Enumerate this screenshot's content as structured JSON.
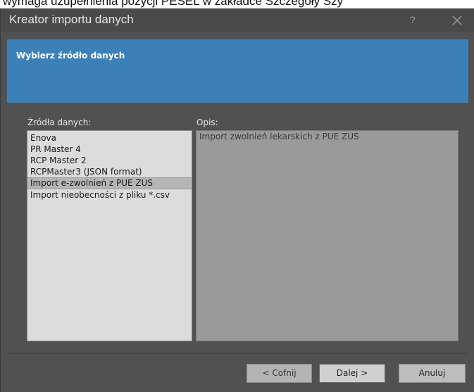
{
  "background_text": "wymaga uzupełnienia pozycji PESEL w zakładce Szczegóły Szy",
  "window": {
    "title": "Kreator importu danych",
    "help_label": "?",
    "close_icon": "close-icon"
  },
  "header": {
    "title": "Wybierz źródło danych"
  },
  "sources": {
    "label": "Źródła danych:",
    "selected_index": 4,
    "items": [
      {
        "label": "Enova"
      },
      {
        "label": "PR Master 4"
      },
      {
        "label": "RCP Master 2"
      },
      {
        "label": "RCPMaster3 (JSON format)"
      },
      {
        "label": "Import e-zwolnień z PUE ZUS"
      },
      {
        "label": "Import nieobecności z pliku *.csv"
      }
    ]
  },
  "description": {
    "label": "Opis:",
    "text": "Import zwolnień lekarskich z PUE ZUS"
  },
  "buttons": {
    "back": "< Cofnij",
    "next": "Dalej >",
    "cancel": "Anuluj"
  },
  "colors": {
    "header_band": "#3c80b8",
    "window_bg": "#515151",
    "list_bg": "#dcdcdc",
    "description_bg": "#9a9a9a"
  }
}
